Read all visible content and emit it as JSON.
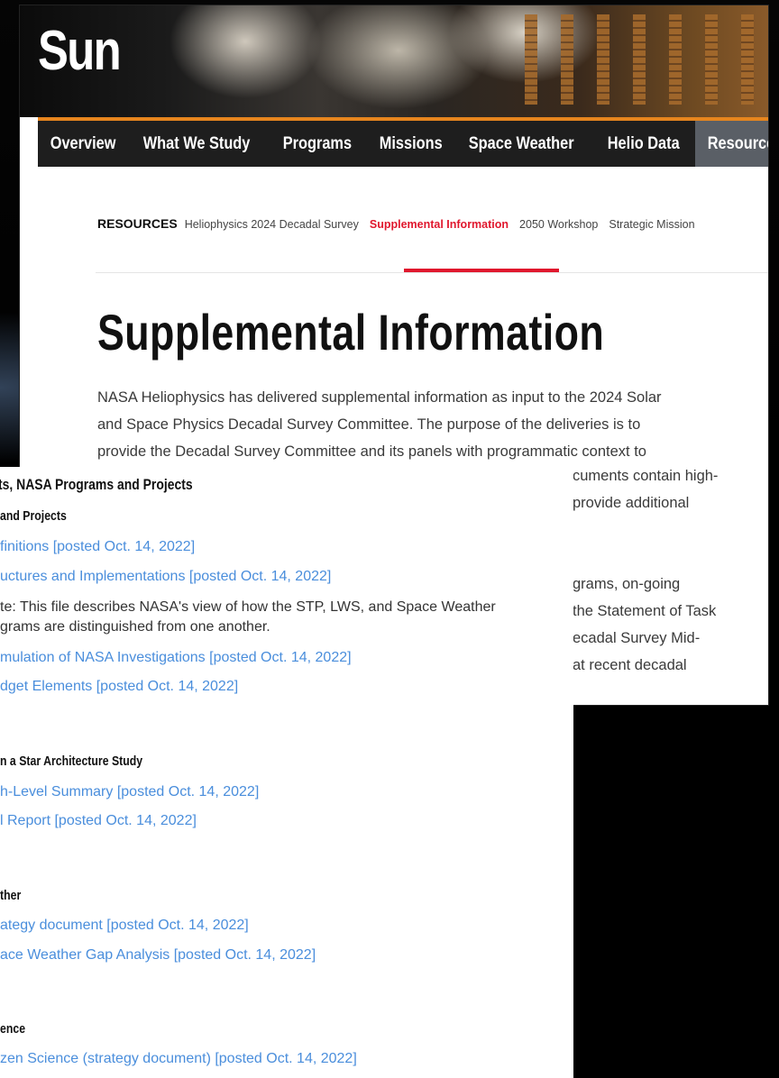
{
  "site": {
    "title": "Sun"
  },
  "nav": {
    "items": [
      {
        "label": "Overview"
      },
      {
        "label": "What We Study"
      },
      {
        "label": "Programs"
      },
      {
        "label": "Missions"
      },
      {
        "label": "Space Weather"
      },
      {
        "label": "Helio Data"
      },
      {
        "label": "Resource"
      }
    ]
  },
  "subnav": {
    "lead": "RESOURCES",
    "items": [
      {
        "label": "Heliophysics 2024 Decadal Survey"
      },
      {
        "label": "Supplemental Information"
      },
      {
        "label": "2050 Workshop"
      },
      {
        "label": "Strategic Mission"
      }
    ]
  },
  "colors": {
    "accent_red": "#e0172d",
    "nav_top": "#e6851e",
    "link": "#4a8edc"
  },
  "page": {
    "title": "Supplemental Information",
    "intro_lines": [
      "NASA Heliophysics has delivered supplemental information as input to the 2024 Solar",
      "and Space Physics Decadal Survey Committee. The purpose of the deliveries is to",
      "provide the Decadal Survey Committee and its panels with programmatic context to"
    ],
    "intro_right_lines": [
      "cuments contain high-",
      "provide additional",
      "",
      "",
      "grams, on-going",
      "the Statement of Task",
      "ecadal Survey Mid-",
      "at recent decadal"
    ]
  },
  "documents": {
    "section1": {
      "title": "ts, NASA Programs and Projects",
      "subtitle": "and Projects",
      "links": [
        "finitions [posted Oct. 14, 2022]",
        "uctures and Implementations [posted Oct. 14, 2022]"
      ],
      "note_lines": [
        "te: This file describes NASA's view of how the STP, LWS, and Space Weather",
        "grams are distinguished from one another."
      ],
      "links2": [
        "mulation of NASA Investigations [posted Oct. 14, 2022]",
        "dget Elements [posted Oct. 14, 2022]"
      ]
    },
    "section2": {
      "subtitle": "n a Star Architecture Study",
      "links": [
        "h-Level Summary [posted Oct. 14, 2022]",
        "l Report [posted Oct. 14, 2022]"
      ]
    },
    "section3": {
      "subtitle": "ther",
      "links": [
        "ategy document [posted Oct. 14, 2022]",
        "ace Weather Gap Analysis [posted Oct. 14, 2022]"
      ]
    },
    "section4": {
      "subtitle": "ence",
      "links": [
        "zen Science (strategy document) [posted Oct. 14, 2022]"
      ]
    }
  }
}
